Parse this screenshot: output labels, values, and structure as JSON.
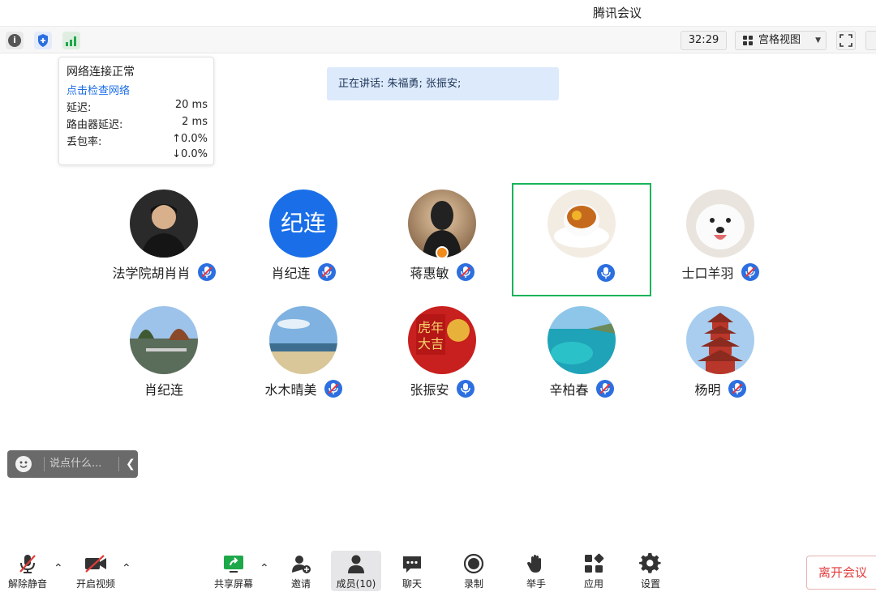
{
  "window": {
    "title": "腾讯会议"
  },
  "topbar": {
    "timer": "32:29",
    "view_mode": "宫格视图"
  },
  "network": {
    "status": "网络连接正常",
    "check_link": "点击检查网络",
    "latency_label": "延迟:",
    "latency_value": "20 ms",
    "router_latency_label": "路由器延迟:",
    "router_latency_value": "2 ms",
    "packet_loss_label": "丢包率:",
    "packet_loss_up": "↑0.0%",
    "packet_loss_down": "↓0.0%"
  },
  "speaking": {
    "text": "正在讲话: 朱福勇; 张振安;"
  },
  "participants": [
    {
      "name": "法学院胡肖肖",
      "mic": "muted"
    },
    {
      "name": "肖纪连",
      "avatar_text": "纪连",
      "mic": "muted"
    },
    {
      "name": "蒋惠敏",
      "mic": "muted",
      "host": true
    },
    {
      "name": "",
      "mic": "on",
      "active": true
    },
    {
      "name": "士口羊羽",
      "mic": "muted"
    },
    {
      "name": "肖纪连",
      "mic": "none"
    },
    {
      "name": "水木晴美",
      "mic": "muted"
    },
    {
      "name": "张振安",
      "mic": "on"
    },
    {
      "name": "辛柏春",
      "mic": "muted"
    },
    {
      "name": "杨明",
      "mic": "muted"
    }
  ],
  "chat": {
    "placeholder": "说点什么..."
  },
  "toolbar": {
    "unmute": "解除静音",
    "start_video": "开启视频",
    "share_screen": "共享屏幕",
    "invite": "邀请",
    "members": "成员(10)",
    "chat": "聊天",
    "record": "录制",
    "raise_hand": "举手",
    "apps": "应用",
    "settings": "设置",
    "leave": "离开会议"
  },
  "colors": {
    "accent": "#2c6fe0",
    "active_border": "#18b45a",
    "leave": "#e23b3b",
    "speaking_bg": "#ddeafc"
  }
}
